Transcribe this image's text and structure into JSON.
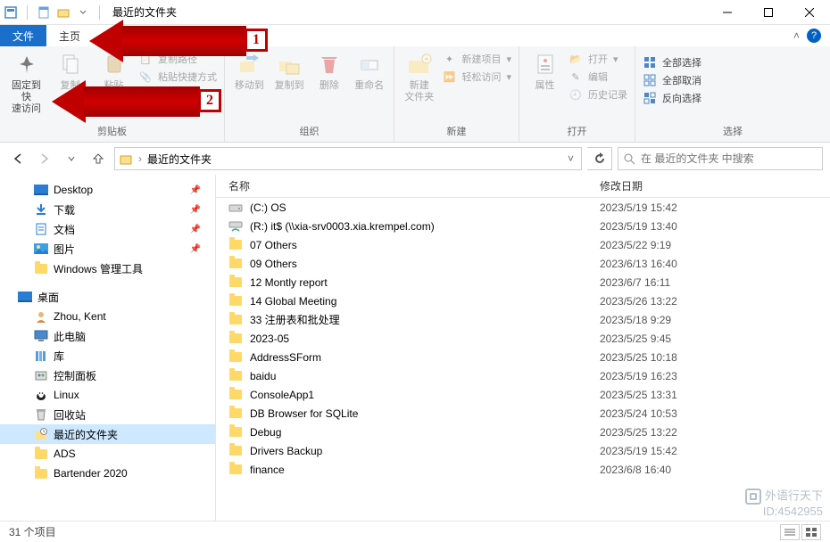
{
  "title": "最近的文件夹",
  "tabs": {
    "file": "文件",
    "home": "主页"
  },
  "ribbon": {
    "clipboard": {
      "pin": "固定到快\n速访问",
      "copy": "复制",
      "paste": "粘贴",
      "copy_path": "复制路径",
      "paste_shortcut": "粘贴快捷方式",
      "label": "剪贴板"
    },
    "organize": {
      "moveto": "移动到",
      "copyto": "复制到",
      "delete": "删除",
      "rename": "重命名",
      "label": "组织"
    },
    "new": {
      "newfolder": "新建\n文件夹",
      "newitem": "新建项目",
      "easyaccess": "轻松访问",
      "label": "新建"
    },
    "open": {
      "properties": "属性",
      "open": "打开",
      "edit": "编辑",
      "history": "历史记录",
      "label": "打开"
    },
    "select": {
      "all": "全部选择",
      "none": "全部取消",
      "invert": "反向选择",
      "label": "选择"
    }
  },
  "breadcrumb": "最近的文件夹",
  "search_placeholder": "在 最近的文件夹 中搜索",
  "sidebar": {
    "items": [
      {
        "label": "Desktop",
        "pin": true,
        "icon": "desktop"
      },
      {
        "label": "下载",
        "pin": true,
        "icon": "download"
      },
      {
        "label": "文档",
        "pin": true,
        "icon": "doc"
      },
      {
        "label": "图片",
        "pin": true,
        "icon": "pic"
      },
      {
        "label": "Windows 管理工具",
        "pin": false,
        "icon": "folder"
      }
    ],
    "section2_label": "桌面",
    "items2": [
      {
        "label": "Zhou, Kent",
        "icon": "user"
      },
      {
        "label": "此电脑",
        "icon": "pc"
      },
      {
        "label": "库",
        "icon": "lib"
      },
      {
        "label": "控制面板",
        "icon": "ctrl"
      },
      {
        "label": "Linux",
        "icon": "linux"
      },
      {
        "label": "回收站",
        "icon": "bin"
      },
      {
        "label": "最近的文件夹",
        "icon": "recent",
        "sel": true
      },
      {
        "label": "ADS",
        "icon": "folder"
      },
      {
        "label": "Bartender 2020",
        "icon": "folder"
      }
    ]
  },
  "columns": {
    "name": "名称",
    "date": "修改日期"
  },
  "files": [
    {
      "name": "(C:) OS",
      "date": "2023/5/19 15:42",
      "icon": "drive"
    },
    {
      "name": "(R:) it$ (\\\\xia-srv0003.xia.krempel.com)",
      "date": "2023/5/19 13:40",
      "icon": "netdrive"
    },
    {
      "name": "07 Others",
      "date": "2023/5/22 9:19",
      "icon": "folder"
    },
    {
      "name": "09 Others",
      "date": "2023/6/13 16:40",
      "icon": "folder"
    },
    {
      "name": "12 Montly report",
      "date": "2023/6/7 16:11",
      "icon": "folder"
    },
    {
      "name": "14 Global Meeting",
      "date": "2023/5/26 13:22",
      "icon": "folder"
    },
    {
      "name": "33 注册表和批处理",
      "date": "2023/5/18 9:29",
      "icon": "folder"
    },
    {
      "name": "2023-05",
      "date": "2023/5/25 9:45",
      "icon": "folder"
    },
    {
      "name": "AddressSForm",
      "date": "2023/5/25 10:18",
      "icon": "folder"
    },
    {
      "name": "baidu",
      "date": "2023/5/19 16:23",
      "icon": "folder"
    },
    {
      "name": "ConsoleApp1",
      "date": "2023/5/25 13:31",
      "icon": "folder"
    },
    {
      "name": "DB Browser for SQLite",
      "date": "2023/5/24 10:53",
      "icon": "folder"
    },
    {
      "name": "Debug",
      "date": "2023/5/25 13:22",
      "icon": "folder"
    },
    {
      "name": "Drivers Backup",
      "date": "2023/5/19 15:42",
      "icon": "folder"
    },
    {
      "name": "finance",
      "date": "2023/6/8 16:40",
      "icon": "folder"
    }
  ],
  "status": "31 个项目",
  "annotations": {
    "n1": "1",
    "n2": "2"
  },
  "watermark": {
    "l1": "外语行天下",
    "l2": "ID:4542955"
  }
}
